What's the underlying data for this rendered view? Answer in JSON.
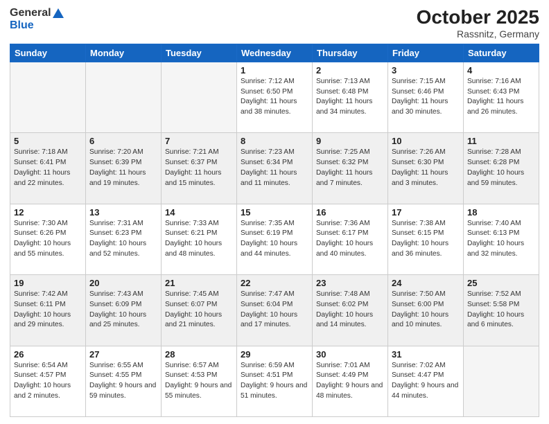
{
  "logo": {
    "general": "General",
    "blue": "Blue"
  },
  "header": {
    "month": "October 2025",
    "location": "Rassnitz, Germany"
  },
  "weekdays": [
    "Sunday",
    "Monday",
    "Tuesday",
    "Wednesday",
    "Thursday",
    "Friday",
    "Saturday"
  ],
  "weeks": [
    [
      {
        "day": "",
        "info": ""
      },
      {
        "day": "",
        "info": ""
      },
      {
        "day": "",
        "info": ""
      },
      {
        "day": "1",
        "info": "Sunrise: 7:12 AM\nSunset: 6:50 PM\nDaylight: 11 hours\nand 38 minutes."
      },
      {
        "day": "2",
        "info": "Sunrise: 7:13 AM\nSunset: 6:48 PM\nDaylight: 11 hours\nand 34 minutes."
      },
      {
        "day": "3",
        "info": "Sunrise: 7:15 AM\nSunset: 6:46 PM\nDaylight: 11 hours\nand 30 minutes."
      },
      {
        "day": "4",
        "info": "Sunrise: 7:16 AM\nSunset: 6:43 PM\nDaylight: 11 hours\nand 26 minutes."
      }
    ],
    [
      {
        "day": "5",
        "info": "Sunrise: 7:18 AM\nSunset: 6:41 PM\nDaylight: 11 hours\nand 22 minutes."
      },
      {
        "day": "6",
        "info": "Sunrise: 7:20 AM\nSunset: 6:39 PM\nDaylight: 11 hours\nand 19 minutes."
      },
      {
        "day": "7",
        "info": "Sunrise: 7:21 AM\nSunset: 6:37 PM\nDaylight: 11 hours\nand 15 minutes."
      },
      {
        "day": "8",
        "info": "Sunrise: 7:23 AM\nSunset: 6:34 PM\nDaylight: 11 hours\nand 11 minutes."
      },
      {
        "day": "9",
        "info": "Sunrise: 7:25 AM\nSunset: 6:32 PM\nDaylight: 11 hours\nand 7 minutes."
      },
      {
        "day": "10",
        "info": "Sunrise: 7:26 AM\nSunset: 6:30 PM\nDaylight: 11 hours\nand 3 minutes."
      },
      {
        "day": "11",
        "info": "Sunrise: 7:28 AM\nSunset: 6:28 PM\nDaylight: 10 hours\nand 59 minutes."
      }
    ],
    [
      {
        "day": "12",
        "info": "Sunrise: 7:30 AM\nSunset: 6:26 PM\nDaylight: 10 hours\nand 55 minutes."
      },
      {
        "day": "13",
        "info": "Sunrise: 7:31 AM\nSunset: 6:23 PM\nDaylight: 10 hours\nand 52 minutes."
      },
      {
        "day": "14",
        "info": "Sunrise: 7:33 AM\nSunset: 6:21 PM\nDaylight: 10 hours\nand 48 minutes."
      },
      {
        "day": "15",
        "info": "Sunrise: 7:35 AM\nSunset: 6:19 PM\nDaylight: 10 hours\nand 44 minutes."
      },
      {
        "day": "16",
        "info": "Sunrise: 7:36 AM\nSunset: 6:17 PM\nDaylight: 10 hours\nand 40 minutes."
      },
      {
        "day": "17",
        "info": "Sunrise: 7:38 AM\nSunset: 6:15 PM\nDaylight: 10 hours\nand 36 minutes."
      },
      {
        "day": "18",
        "info": "Sunrise: 7:40 AM\nSunset: 6:13 PM\nDaylight: 10 hours\nand 32 minutes."
      }
    ],
    [
      {
        "day": "19",
        "info": "Sunrise: 7:42 AM\nSunset: 6:11 PM\nDaylight: 10 hours\nand 29 minutes."
      },
      {
        "day": "20",
        "info": "Sunrise: 7:43 AM\nSunset: 6:09 PM\nDaylight: 10 hours\nand 25 minutes."
      },
      {
        "day": "21",
        "info": "Sunrise: 7:45 AM\nSunset: 6:07 PM\nDaylight: 10 hours\nand 21 minutes."
      },
      {
        "day": "22",
        "info": "Sunrise: 7:47 AM\nSunset: 6:04 PM\nDaylight: 10 hours\nand 17 minutes."
      },
      {
        "day": "23",
        "info": "Sunrise: 7:48 AM\nSunset: 6:02 PM\nDaylight: 10 hours\nand 14 minutes."
      },
      {
        "day": "24",
        "info": "Sunrise: 7:50 AM\nSunset: 6:00 PM\nDaylight: 10 hours\nand 10 minutes."
      },
      {
        "day": "25",
        "info": "Sunrise: 7:52 AM\nSunset: 5:58 PM\nDaylight: 10 hours\nand 6 minutes."
      }
    ],
    [
      {
        "day": "26",
        "info": "Sunrise: 6:54 AM\nSunset: 4:57 PM\nDaylight: 10 hours\nand 2 minutes."
      },
      {
        "day": "27",
        "info": "Sunrise: 6:55 AM\nSunset: 4:55 PM\nDaylight: 9 hours\nand 59 minutes."
      },
      {
        "day": "28",
        "info": "Sunrise: 6:57 AM\nSunset: 4:53 PM\nDaylight: 9 hours\nand 55 minutes."
      },
      {
        "day": "29",
        "info": "Sunrise: 6:59 AM\nSunset: 4:51 PM\nDaylight: 9 hours\nand 51 minutes."
      },
      {
        "day": "30",
        "info": "Sunrise: 7:01 AM\nSunset: 4:49 PM\nDaylight: 9 hours\nand 48 minutes."
      },
      {
        "day": "31",
        "info": "Sunrise: 7:02 AM\nSunset: 4:47 PM\nDaylight: 9 hours\nand 44 minutes."
      },
      {
        "day": "",
        "info": ""
      }
    ]
  ]
}
